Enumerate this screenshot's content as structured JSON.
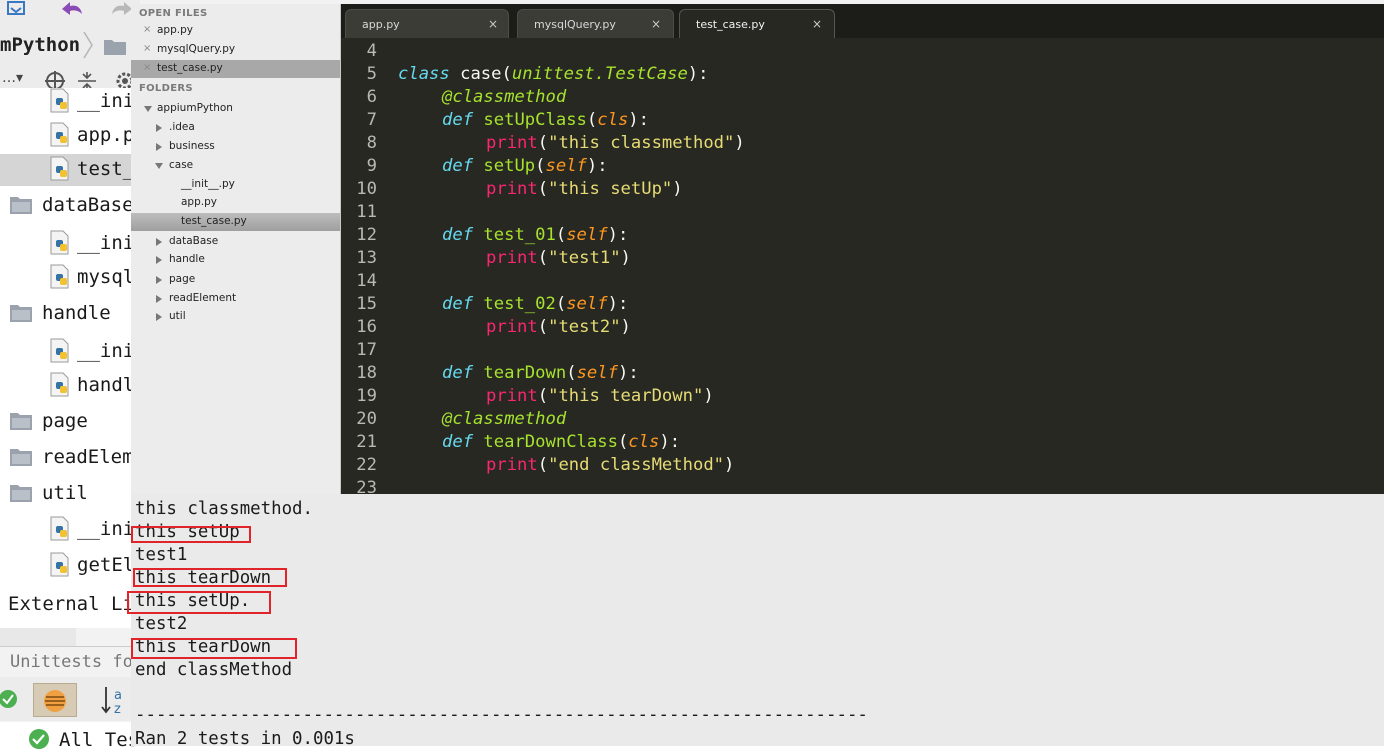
{
  "colors": {
    "editor_bg": "#272822",
    "keyword": "#66d9ef",
    "function_name": "#a6e22e",
    "parameter": "#fd971f",
    "builtin": "#f92672",
    "string": "#e6db74",
    "highlight_box": "#e0242a",
    "console_bg": "#eaeaea"
  },
  "ide": {
    "breadcrumb": "mPython",
    "tree": [
      {
        "label": "__ini",
        "icon": "python-file-icon"
      },
      {
        "label": "app.p",
        "icon": "python-file-icon"
      },
      {
        "label": "test_",
        "icon": "python-file-icon"
      },
      {
        "label": "dataBase",
        "icon": "folder-icon"
      },
      {
        "label": "__ini",
        "icon": "python-file-icon"
      },
      {
        "label": "mysql",
        "icon": "python-file-icon"
      },
      {
        "label": "handle",
        "icon": "folder-icon"
      },
      {
        "label": "__ini",
        "icon": "python-file-icon"
      },
      {
        "label": "handl",
        "icon": "python-file-icon"
      },
      {
        "label": "page",
        "icon": "folder-icon"
      },
      {
        "label": "readElem",
        "icon": "folder-icon"
      },
      {
        "label": "util",
        "icon": "folder-icon"
      },
      {
        "label": "__ini",
        "icon": "python-file-icon"
      },
      {
        "label": "getEl",
        "icon": "python-file-icon"
      }
    ],
    "external_libs": "External Li",
    "unittests_label": "Unittests fo",
    "all_tests": "All Tes"
  },
  "sublime": {
    "sidebar": {
      "open_files_header": "OPEN FILES",
      "open_files": [
        "app.py",
        "mysqlQuery.py",
        "test_case.py"
      ],
      "folders_header": "FOLDERS",
      "root": "appiumPython",
      "folders": [
        ".idea",
        "business",
        "case"
      ],
      "case_children": [
        "__init__.py",
        "app.py",
        "test_case.py"
      ],
      "folders_after": [
        "dataBase",
        "handle",
        "page",
        "readElement",
        "util"
      ]
    },
    "tabs": [
      {
        "label": "app.py",
        "close": "×"
      },
      {
        "label": "mysqlQuery.py",
        "close": "×"
      },
      {
        "label": "test_case.py",
        "close": "×"
      }
    ],
    "code": {
      "ln4": "4",
      "ln5": "5",
      "l5_class": "class",
      "l5_name": "case",
      "l5_base": "unittest.TestCase",
      "ln6": "6",
      "l6_dec": "@classmethod",
      "ln7": "7",
      "l7_def": "def",
      "l7_name": "setUpClass",
      "l7_par": "cls",
      "ln8": "8",
      "l8_print": "print",
      "l8_str": "\"this classmethod\"",
      "ln9": "9",
      "l9_def": "def",
      "l9_name": "setUp",
      "l9_par": "self",
      "ln10": "10",
      "l10_print": "print",
      "l10_str": "\"this setUp\"",
      "ln11": "11",
      "ln12": "12",
      "l12_def": "def",
      "l12_name": "test_01",
      "l12_par": "self",
      "ln13": "13",
      "l13_print": "print",
      "l13_str": "\"test1\"",
      "ln14": "14",
      "ln15": "15",
      "l15_def": "def",
      "l15_name": "test_02",
      "l15_par": "self",
      "ln16": "16",
      "l16_print": "print",
      "l16_str": "\"test2\"",
      "ln17": "17",
      "ln18": "18",
      "l18_def": "def",
      "l18_name": "tearDown",
      "l18_par": "self",
      "ln19": "19",
      "l19_print": "print",
      "l19_str": "\"this tearDown\"",
      "ln20": "20",
      "l20_dec": "@classmethod",
      "ln21": "21",
      "l21_def": "def",
      "l21_name": "tearDownClass",
      "l21_par": "cls",
      "ln22": "22",
      "l22_print": "print",
      "l22_str": "\"end classMethod\"",
      "ln23": "23"
    }
  },
  "console": {
    "lines": [
      "this classmethod.",
      "this setUp",
      "test1",
      "this tearDown",
      "this setUp.",
      "test2",
      "this tearDown",
      "end classMethod",
      "",
      "----------------------------------------------------------------------",
      "Ran 2 tests in 0.001s"
    ]
  }
}
